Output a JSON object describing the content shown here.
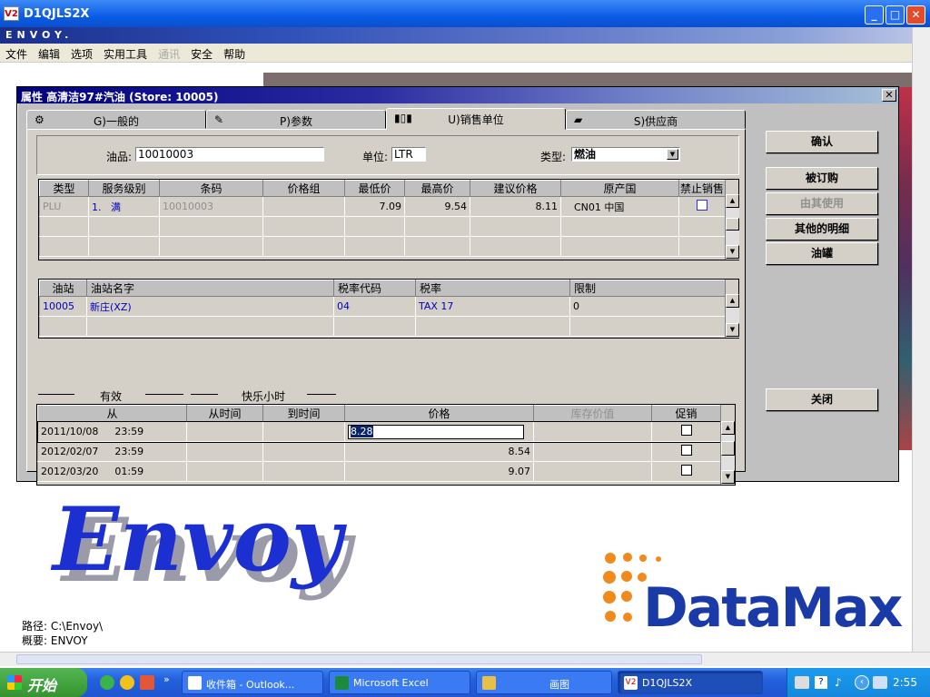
{
  "window": {
    "app_icon": "V2",
    "title": "D1QJLS2X"
  },
  "banner": {
    "text": "ENVOY."
  },
  "menu": [
    {
      "label": "文件",
      "disabled": false
    },
    {
      "label": "编辑",
      "disabled": false
    },
    {
      "label": "选项",
      "disabled": false
    },
    {
      "label": "实用工具",
      "disabled": false
    },
    {
      "label": "通讯",
      "disabled": true
    },
    {
      "label": "安全",
      "disabled": false
    },
    {
      "label": "帮助",
      "disabled": false
    }
  ],
  "dialog": {
    "title": "属性 高清洁97#汽油 (Store: 10005)",
    "tabs": [
      "G)一般的",
      "P)参数",
      "U)销售单位",
      "S)供应商"
    ],
    "active_tab": 2,
    "fields": {
      "product_label": "油品:",
      "product_value": "10010003",
      "unit_label": "单位:",
      "unit_value": "LTR",
      "type_label": "类型:",
      "type_value": "燃油"
    },
    "sales_grid": {
      "headers": [
        "类型",
        "服务级别",
        "条码",
        "价格组",
        "最低价",
        "最高价",
        "建议价格",
        "原产国",
        "禁止销售"
      ],
      "rows": [
        {
          "type": "PLU",
          "level": "1.",
          "level_name": "满",
          "barcode": "10010003",
          "price_group": "",
          "min": "7.09",
          "max": "9.54",
          "suggested": "8.11",
          "origin": "CN01 中国"
        }
      ]
    },
    "station_grid": {
      "headers": [
        "油站",
        "油站名字",
        "税率代码",
        "税率",
        "限制"
      ],
      "rows": [
        {
          "id": "10005",
          "name": "新庄(XZ)",
          "tax_code": "04",
          "tax": "TAX 17",
          "limit": "0"
        }
      ]
    },
    "groups": {
      "valid": "有效",
      "happy_hour": "快乐小时"
    },
    "price_grid": {
      "headers": [
        "从",
        "从时间",
        "到时间",
        "价格",
        "库存价值",
        "促销"
      ],
      "rows": [
        {
          "date": "2011/10/08",
          "time": "23:59",
          "price": "8.28"
        },
        {
          "date": "2012/02/07",
          "time": "23:59",
          "price": "8.54"
        },
        {
          "date": "2012/03/20",
          "time": "01:59",
          "price": "9.07"
        }
      ]
    },
    "buttons": {
      "ok": "确认",
      "ordered": "被订购",
      "used_by_other": "由其使用",
      "other_details": "其他的明细",
      "tank": "油罐",
      "close": "关闭"
    }
  },
  "logos": {
    "envoy": "Envoy",
    "datamax": "DataMax"
  },
  "path_info": {
    "path": "路径: C:\\Envoy\\",
    "summary": "概要: ENVOY"
  },
  "taskbar": {
    "start": "开始",
    "tasks": [
      "收件箱 - Outlook...",
      "Microsoft Excel",
      "画图",
      "D1QJLS2X"
    ],
    "clock": "2:55"
  }
}
